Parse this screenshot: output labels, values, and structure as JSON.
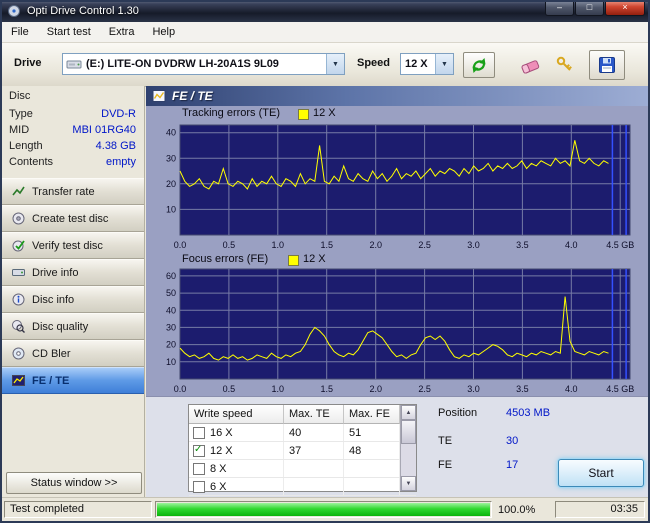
{
  "window": {
    "title": "Opti Drive Control 1.30",
    "controls": {
      "minimize": "–",
      "maximize": "□",
      "close": "×"
    }
  },
  "menu": {
    "items": [
      {
        "label": "File"
      },
      {
        "label": "Start test"
      },
      {
        "label": "Extra"
      },
      {
        "label": "Help"
      }
    ]
  },
  "toolbar": {
    "drive_label": "Drive",
    "drive_value": "(E:) LITE-ON DVDRW LH-20A1S 9L09",
    "speed_label": "Speed",
    "speed_value": "12 X",
    "icon_names": [
      "optical-drive-icon",
      "refresh-icon",
      "eraser-icon",
      "keys-icon",
      "save-icon"
    ]
  },
  "icons": {
    "combo_arrow": "▼",
    "scroll_up": "▲",
    "scroll_down": "▼",
    "check": "✓"
  },
  "sidebar": {
    "disc": {
      "caption": "Disc",
      "fields": [
        {
          "label": "Type",
          "value": "DVD-R"
        },
        {
          "label": "MID",
          "value": "MBI 01RG40"
        },
        {
          "label": "Length",
          "value": "4.38 GB"
        },
        {
          "label": "Contents",
          "value": "empty"
        }
      ]
    },
    "buttons": [
      {
        "label": "Transfer rate",
        "icon": "transfer-rate-icon",
        "selected": false
      },
      {
        "label": "Create test disc",
        "icon": "create-test-disc-icon",
        "selected": false
      },
      {
        "label": "Verify test disc",
        "icon": "verify-test-disc-icon",
        "selected": false
      },
      {
        "label": "Drive info",
        "icon": "drive-info-icon",
        "selected": false
      },
      {
        "label": "Disc info",
        "icon": "disc-info-icon",
        "selected": false
      },
      {
        "label": "Disc quality",
        "icon": "disc-quality-icon",
        "selected": false
      },
      {
        "label": "CD Bler",
        "icon": "cd-bler-icon",
        "selected": false
      },
      {
        "label": "FE / TE",
        "icon": "fe-te-icon",
        "selected": true
      }
    ],
    "status_window_button": "Status window >>"
  },
  "main": {
    "header": "FE / TE",
    "table": {
      "headers": [
        "Write speed",
        "Max. TE",
        "Max. FE"
      ],
      "rows": [
        {
          "checked": false,
          "speed": "16 X",
          "max_te": "40",
          "max_fe": "51"
        },
        {
          "checked": true,
          "speed": "12 X",
          "max_te": "37",
          "max_fe": "48"
        },
        {
          "checked": false,
          "speed": "8 X",
          "max_te": "",
          "max_fe": ""
        },
        {
          "checked": false,
          "speed": "6 X",
          "max_te": "",
          "max_fe": ""
        }
      ]
    },
    "results": {
      "position_label": "Position",
      "position_value": "4503 MB",
      "te_label": "TE",
      "te_value": "30",
      "fe_label": "FE",
      "fe_value": "17"
    },
    "start_button": "Start"
  },
  "chart_data": [
    {
      "name": "te",
      "type": "line",
      "title": "Tracking errors (TE)",
      "legend": "12 X",
      "xlim": [
        0,
        4.6
      ],
      "ylim": [
        0,
        43
      ],
      "yticks": [
        10,
        20,
        30,
        40
      ],
      "xticks": [
        0,
        0.5,
        1,
        1.5,
        2,
        2.5,
        3,
        3.5,
        4,
        4.5
      ],
      "xtick_labels": [
        "0.0",
        "0.5",
        "1.0",
        "1.5",
        "2.0",
        "2.5",
        "3.0",
        "3.5",
        "4.0",
        "4.5 GB"
      ],
      "x_end": 4.38,
      "markers": [
        4.42,
        4.56
      ],
      "plot_bg": "#1c1c6e",
      "grid_color": "#767ba6",
      "marker_color": "#3450ff",
      "series_color": "#ffff00",
      "values": [
        25,
        21,
        19,
        20,
        22,
        19,
        18,
        21,
        20,
        26,
        20,
        19,
        21,
        20,
        18,
        22,
        19,
        21,
        20,
        23,
        20,
        19,
        22,
        21,
        19,
        24,
        20,
        22,
        21,
        35,
        21,
        20,
        23,
        21,
        27,
        22,
        21,
        24,
        22,
        21,
        25,
        22,
        24,
        21,
        23,
        26,
        22,
        24,
        23,
        25,
        22,
        24,
        26,
        23,
        25,
        24,
        26,
        25,
        23,
        26,
        24,
        27,
        25,
        26,
        28,
        25,
        27,
        26,
        28,
        26,
        27,
        29,
        26,
        28,
        27,
        29,
        28,
        27,
        30,
        28,
        29,
        27,
        37,
        29,
        28,
        30,
        28,
        27,
        29,
        28
      ]
    },
    {
      "name": "fe",
      "type": "line",
      "title": "Focus errors (FE)",
      "legend": "12 X",
      "xlim": [
        0,
        4.6
      ],
      "ylim": [
        0,
        64
      ],
      "yticks": [
        10,
        20,
        30,
        40,
        50,
        60
      ],
      "xticks": [
        0,
        0.5,
        1,
        1.5,
        2,
        2.5,
        3,
        3.5,
        4,
        4.5
      ],
      "xtick_labels": [
        "0.0",
        "0.5",
        "1.0",
        "1.5",
        "2.0",
        "2.5",
        "3.0",
        "3.5",
        "4.0",
        "4.5 GB"
      ],
      "x_end": 4.38,
      "markers": [
        4.42,
        4.56
      ],
      "plot_bg": "#1c1c6e",
      "grid_color": "#767ba6",
      "marker_color": "#3450ff",
      "series_color": "#ffff00",
      "values": [
        18,
        15,
        13,
        14,
        12,
        13,
        15,
        12,
        11,
        13,
        12,
        14,
        12,
        13,
        11,
        12,
        14,
        13,
        12,
        15,
        13,
        12,
        14,
        13,
        15,
        16,
        20,
        26,
        30,
        28,
        25,
        20,
        16,
        14,
        13,
        15,
        14,
        17,
        22,
        27,
        28,
        26,
        24,
        20,
        16,
        13,
        14,
        12,
        14,
        15,
        20,
        24,
        25,
        23,
        25,
        22,
        17,
        13,
        12,
        14,
        13,
        15,
        14,
        16,
        18,
        20,
        19,
        17,
        14,
        13,
        15,
        14,
        13,
        15,
        14,
        16,
        15,
        14,
        16,
        15,
        48,
        22,
        16,
        15,
        14,
        16,
        15,
        14,
        16,
        15
      ]
    }
  ],
  "statusbar": {
    "status": "Test completed",
    "percent": "100.0%",
    "progress_value": 100,
    "time": "03:35"
  },
  "colors": {
    "value_text": "#0016c8",
    "selected_nav": "#3f7fd8",
    "plot_bg": "#1c1c6e",
    "series_yellow": "#ffff00",
    "marker_blue": "#3450ff",
    "progress_green": "#22cc22"
  }
}
